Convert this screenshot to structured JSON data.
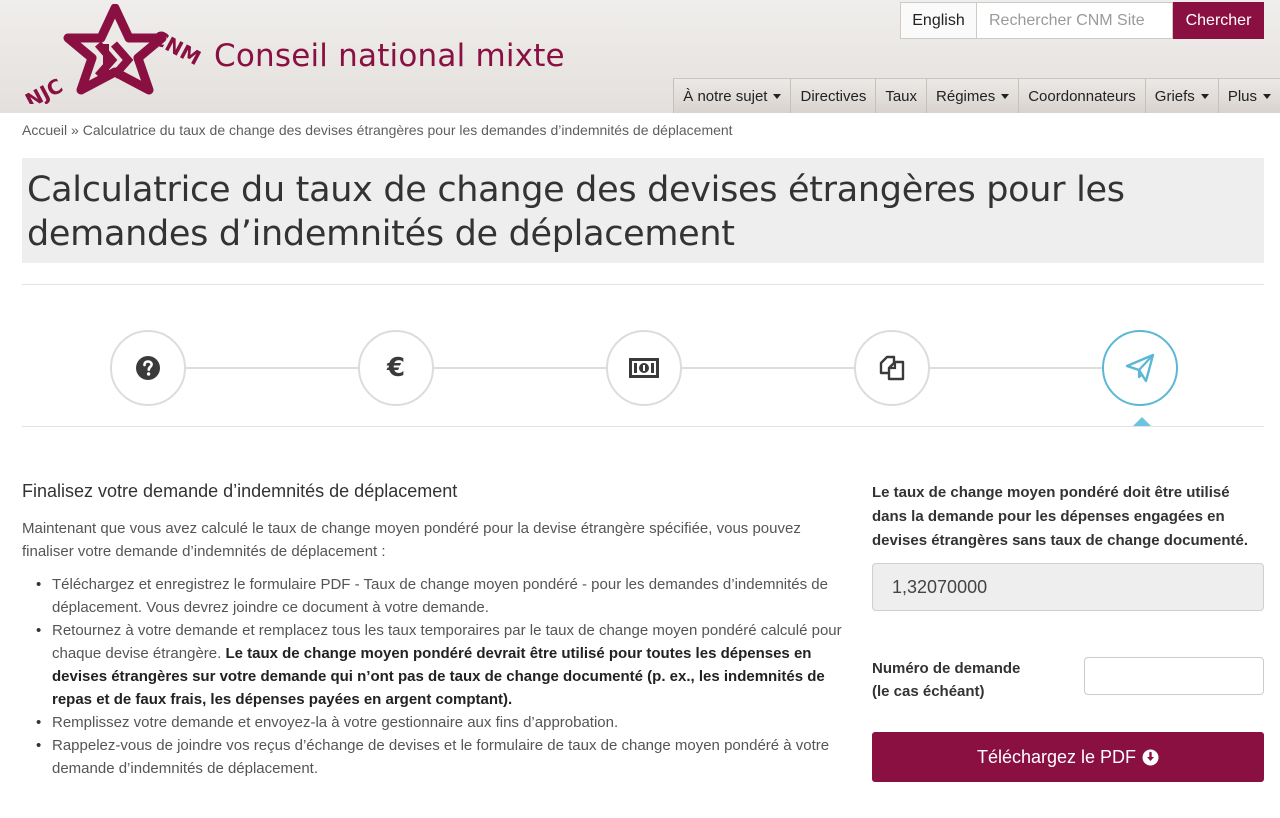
{
  "header": {
    "logo_text_left": "NJC",
    "logo_text_right": "CNM",
    "site_title": "Conseil national mixte",
    "language_label": "English",
    "search_placeholder": "Rechercher CNM Site",
    "search_button": "Chercher"
  },
  "nav": [
    {
      "label": "À notre sujet",
      "dropdown": true
    },
    {
      "label": "Directives",
      "dropdown": false
    },
    {
      "label": "Taux",
      "dropdown": false
    },
    {
      "label": "Régimes",
      "dropdown": true
    },
    {
      "label": "Coordonnateurs",
      "dropdown": false
    },
    {
      "label": "Griefs",
      "dropdown": true
    },
    {
      "label": "Plus",
      "dropdown": true
    }
  ],
  "breadcrumb": {
    "home": "Accueil",
    "separator": " » ",
    "current": "Calculatrice du taux de change des devises étrangères pour les demandes d’indemnités de déplacement"
  },
  "page_title": "Calculatrice du taux de change des devises étrangères pour les demandes d’indemnités de déplacement",
  "steps": [
    {
      "icon": "question-circle-icon",
      "active": false
    },
    {
      "icon": "euro-icon",
      "active": false
    },
    {
      "icon": "money-bill-icon",
      "active": false
    },
    {
      "icon": "copy-documents-icon",
      "active": false
    },
    {
      "icon": "paper-plane-icon",
      "active": true
    }
  ],
  "main": {
    "section_title": "Finalisez votre demande d’indemnités de déplacement",
    "intro": "Maintenant que vous avez calculé le taux de change moyen pondéré pour la devise étrangère spécifiée, vous pouvez finaliser votre demande d’indemnités de déplacement :",
    "bullets": {
      "b1": "Téléchargez et enregistrez le formulaire PDF - Taux de change moyen pondéré - pour les demandes d’indemnités de déplacement. Vous devrez joindre ce document à votre demande.",
      "b2_normal": "Retournez à votre demande et remplacez tous les taux temporaires par le taux de change moyen pondéré calculé pour chaque devise étrangère. ",
      "b2_bold": "Le taux de change moyen pondéré devrait être utilisé pour toutes les dépenses en devises étrangères sur votre demande qui n’ont pas de taux de change documenté (p. ex., les indemnités de repas et de faux frais, les dépenses payées en argent comptant).",
      "b3": "Remplissez votre demande et envoyez-la à votre gestionnaire aux fins d’approbation.",
      "b4": "Rappelez-vous de joindre vos reçus d’échange de devises et le formulaire de taux de change moyen pondéré à votre demande d’indemnités de déplacement."
    }
  },
  "sidebar": {
    "rate_note": "Le taux de change moyen pondéré doit être utilisé dans la demande pour les dépenses engagées en devises étrangères sans taux de change documenté.",
    "rate_value": "1,32070000",
    "claim_label_line1": "Numéro de demande",
    "claim_label_line2": "(le cas échéant)",
    "claim_value": "",
    "download_button": "Téléchargez le PDF"
  },
  "colors": {
    "brand": "#8a1042",
    "active_step": "#5bb8d4"
  }
}
